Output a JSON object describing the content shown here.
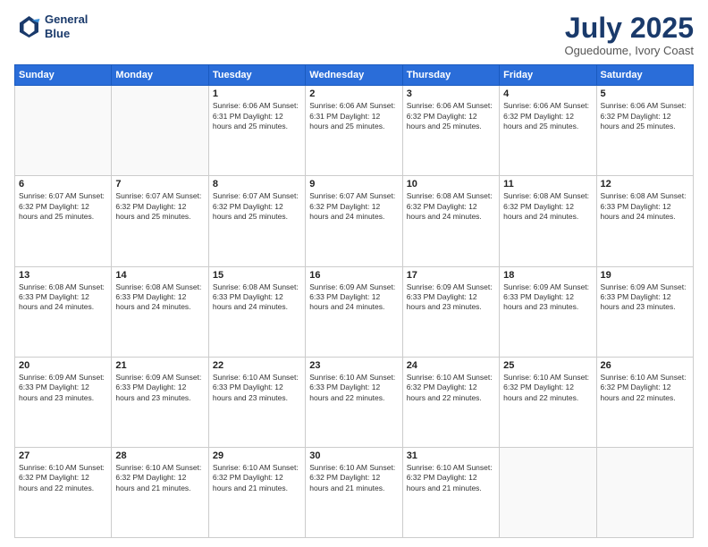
{
  "header": {
    "logo_line1": "General",
    "logo_line2": "Blue",
    "month_title": "July 2025",
    "location": "Oguedoume, Ivory Coast"
  },
  "weekdays": [
    "Sunday",
    "Monday",
    "Tuesday",
    "Wednesday",
    "Thursday",
    "Friday",
    "Saturday"
  ],
  "weeks": [
    [
      {
        "day": "",
        "info": ""
      },
      {
        "day": "",
        "info": ""
      },
      {
        "day": "1",
        "info": "Sunrise: 6:06 AM\nSunset: 6:31 PM\nDaylight: 12 hours and 25 minutes."
      },
      {
        "day": "2",
        "info": "Sunrise: 6:06 AM\nSunset: 6:31 PM\nDaylight: 12 hours and 25 minutes."
      },
      {
        "day": "3",
        "info": "Sunrise: 6:06 AM\nSunset: 6:32 PM\nDaylight: 12 hours and 25 minutes."
      },
      {
        "day": "4",
        "info": "Sunrise: 6:06 AM\nSunset: 6:32 PM\nDaylight: 12 hours and 25 minutes."
      },
      {
        "day": "5",
        "info": "Sunrise: 6:06 AM\nSunset: 6:32 PM\nDaylight: 12 hours and 25 minutes."
      }
    ],
    [
      {
        "day": "6",
        "info": "Sunrise: 6:07 AM\nSunset: 6:32 PM\nDaylight: 12 hours and 25 minutes."
      },
      {
        "day": "7",
        "info": "Sunrise: 6:07 AM\nSunset: 6:32 PM\nDaylight: 12 hours and 25 minutes."
      },
      {
        "day": "8",
        "info": "Sunrise: 6:07 AM\nSunset: 6:32 PM\nDaylight: 12 hours and 25 minutes."
      },
      {
        "day": "9",
        "info": "Sunrise: 6:07 AM\nSunset: 6:32 PM\nDaylight: 12 hours and 24 minutes."
      },
      {
        "day": "10",
        "info": "Sunrise: 6:08 AM\nSunset: 6:32 PM\nDaylight: 12 hours and 24 minutes."
      },
      {
        "day": "11",
        "info": "Sunrise: 6:08 AM\nSunset: 6:32 PM\nDaylight: 12 hours and 24 minutes."
      },
      {
        "day": "12",
        "info": "Sunrise: 6:08 AM\nSunset: 6:33 PM\nDaylight: 12 hours and 24 minutes."
      }
    ],
    [
      {
        "day": "13",
        "info": "Sunrise: 6:08 AM\nSunset: 6:33 PM\nDaylight: 12 hours and 24 minutes."
      },
      {
        "day": "14",
        "info": "Sunrise: 6:08 AM\nSunset: 6:33 PM\nDaylight: 12 hours and 24 minutes."
      },
      {
        "day": "15",
        "info": "Sunrise: 6:08 AM\nSunset: 6:33 PM\nDaylight: 12 hours and 24 minutes."
      },
      {
        "day": "16",
        "info": "Sunrise: 6:09 AM\nSunset: 6:33 PM\nDaylight: 12 hours and 24 minutes."
      },
      {
        "day": "17",
        "info": "Sunrise: 6:09 AM\nSunset: 6:33 PM\nDaylight: 12 hours and 23 minutes."
      },
      {
        "day": "18",
        "info": "Sunrise: 6:09 AM\nSunset: 6:33 PM\nDaylight: 12 hours and 23 minutes."
      },
      {
        "day": "19",
        "info": "Sunrise: 6:09 AM\nSunset: 6:33 PM\nDaylight: 12 hours and 23 minutes."
      }
    ],
    [
      {
        "day": "20",
        "info": "Sunrise: 6:09 AM\nSunset: 6:33 PM\nDaylight: 12 hours and 23 minutes."
      },
      {
        "day": "21",
        "info": "Sunrise: 6:09 AM\nSunset: 6:33 PM\nDaylight: 12 hours and 23 minutes."
      },
      {
        "day": "22",
        "info": "Sunrise: 6:10 AM\nSunset: 6:33 PM\nDaylight: 12 hours and 23 minutes."
      },
      {
        "day": "23",
        "info": "Sunrise: 6:10 AM\nSunset: 6:33 PM\nDaylight: 12 hours and 22 minutes."
      },
      {
        "day": "24",
        "info": "Sunrise: 6:10 AM\nSunset: 6:32 PM\nDaylight: 12 hours and 22 minutes."
      },
      {
        "day": "25",
        "info": "Sunrise: 6:10 AM\nSunset: 6:32 PM\nDaylight: 12 hours and 22 minutes."
      },
      {
        "day": "26",
        "info": "Sunrise: 6:10 AM\nSunset: 6:32 PM\nDaylight: 12 hours and 22 minutes."
      }
    ],
    [
      {
        "day": "27",
        "info": "Sunrise: 6:10 AM\nSunset: 6:32 PM\nDaylight: 12 hours and 22 minutes."
      },
      {
        "day": "28",
        "info": "Sunrise: 6:10 AM\nSunset: 6:32 PM\nDaylight: 12 hours and 21 minutes."
      },
      {
        "day": "29",
        "info": "Sunrise: 6:10 AM\nSunset: 6:32 PM\nDaylight: 12 hours and 21 minutes."
      },
      {
        "day": "30",
        "info": "Sunrise: 6:10 AM\nSunset: 6:32 PM\nDaylight: 12 hours and 21 minutes."
      },
      {
        "day": "31",
        "info": "Sunrise: 6:10 AM\nSunset: 6:32 PM\nDaylight: 12 hours and 21 minutes."
      },
      {
        "day": "",
        "info": ""
      },
      {
        "day": "",
        "info": ""
      }
    ]
  ]
}
